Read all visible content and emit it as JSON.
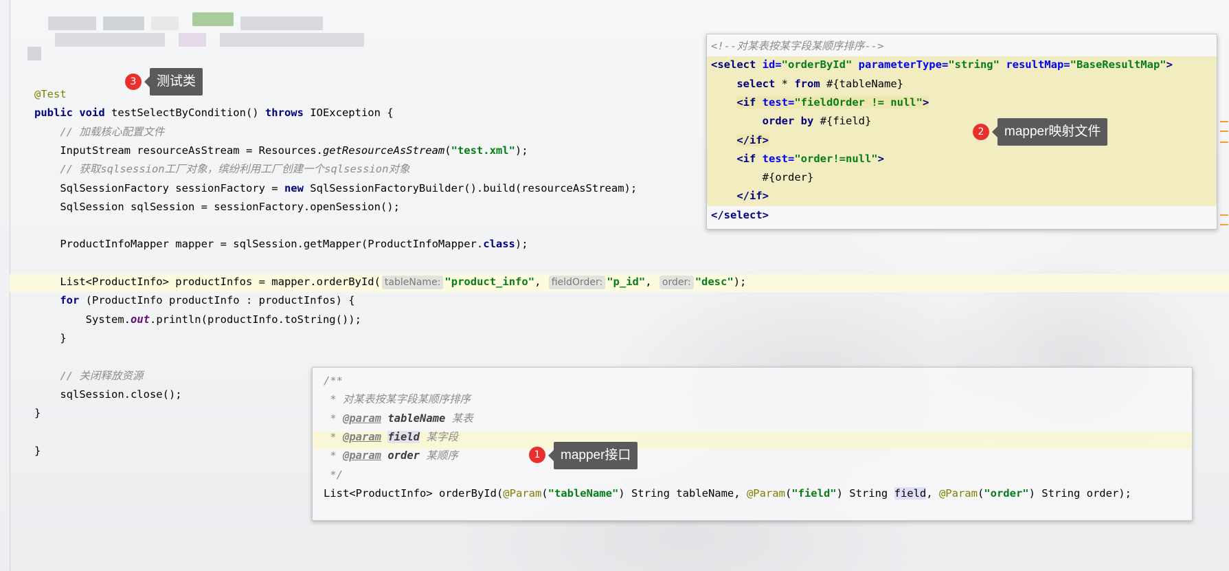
{
  "test_class": {
    "lines": [
      {
        "parts": [
          {
            "t": "@Test",
            "c": "ann"
          }
        ]
      },
      {
        "parts": [
          {
            "t": "public ",
            "c": "kw"
          },
          {
            "t": "void ",
            "c": "kw"
          },
          {
            "t": "testSelectByCondition() "
          },
          {
            "t": "throws ",
            "c": "kw"
          },
          {
            "t": "IOException {"
          }
        ]
      },
      {
        "parts": [
          {
            "t": "    // 加载核心配置文件",
            "c": "cmt"
          }
        ]
      },
      {
        "parts": [
          {
            "t": "    InputStream resourceAsStream = Resources."
          },
          {
            "t": "getResourceAsStream",
            "c": "static"
          },
          {
            "t": "("
          },
          {
            "t": "\"test.xml\"",
            "c": "str"
          },
          {
            "t": ");"
          }
        ]
      },
      {
        "parts": [
          {
            "t": "    // 获取sqlsession工厂对象，缤纷利用工厂创建一个sqlsession对象",
            "c": "cmt"
          }
        ]
      },
      {
        "parts": [
          {
            "t": "    SqlSessionFactory sessionFactory = "
          },
          {
            "t": "new ",
            "c": "kw"
          },
          {
            "t": "SqlSessionFactoryBuilder().build(resourceAsStream);"
          }
        ]
      },
      {
        "parts": [
          {
            "t": "    SqlSession sqlSession = sessionFactory.openSession();"
          }
        ]
      },
      {
        "parts": []
      },
      {
        "parts": [
          {
            "t": "    ProductInfoMapper mapper = sqlSession.getMapper(ProductInfoMapper."
          },
          {
            "t": "class",
            "c": "kw"
          },
          {
            "t": ");"
          }
        ]
      },
      {
        "parts": []
      },
      {
        "parts": [
          {
            "t": "    List<ProductInfo> productInfos = mapper.orderById("
          },
          {
            "t": "tableName:",
            "c": "hint"
          },
          {
            "t": "\"product_info\"",
            "c": "str"
          },
          {
            "t": ", "
          },
          {
            "t": "fieldOrder:",
            "c": "hint"
          },
          {
            "t": "\"p_id\"",
            "c": "str"
          },
          {
            "t": ", "
          },
          {
            "t": "order:",
            "c": "hint"
          },
          {
            "t": "\"desc\"",
            "c": "str"
          },
          {
            "t": ");"
          }
        ]
      },
      {
        "parts": [
          {
            "t": "    "
          },
          {
            "t": "for ",
            "c": "kw"
          },
          {
            "t": "(ProductInfo productInfo : productInfos) {"
          }
        ]
      },
      {
        "parts": [
          {
            "t": "        System."
          },
          {
            "t": "out",
            "c": "field"
          },
          {
            "t": ".println(productInfo.toString());"
          }
        ]
      },
      {
        "parts": [
          {
            "t": "    }"
          }
        ]
      },
      {
        "parts": []
      },
      {
        "parts": [
          {
            "t": "    // 关闭释放资源",
            "c": "cmt"
          }
        ]
      },
      {
        "parts": [
          {
            "t": "    sqlSession.close();"
          }
        ]
      },
      {
        "parts": [
          {
            "t": "}"
          }
        ]
      },
      {
        "parts": []
      },
      {
        "parts": [
          {
            "t": "}"
          }
        ]
      }
    ]
  },
  "mapper_xml": {
    "lines": [
      {
        "parts": [
          {
            "t": "<!--对某表按某字段某顺序排序-->",
            "c": "cmt"
          }
        ]
      },
      {
        "parts": [
          {
            "t": "<select ",
            "c": "xml-tag"
          },
          {
            "t": "id=",
            "c": "xml-attr"
          },
          {
            "t": "\"orderById\"",
            "c": "xml-val"
          },
          {
            "t": " "
          },
          {
            "t": "parameterType=",
            "c": "xml-attr"
          },
          {
            "t": "\"string\"",
            "c": "xml-val"
          },
          {
            "t": " "
          },
          {
            "t": "resultMap=",
            "c": "xml-attr"
          },
          {
            "t": "\"BaseResultMap\"",
            "c": "xml-val"
          },
          {
            "t": ">",
            "c": "xml-tag"
          }
        ]
      },
      {
        "parts": [
          {
            "t": "    "
          },
          {
            "t": "select ",
            "c": "kw"
          },
          {
            "t": "* "
          },
          {
            "t": "from ",
            "c": "kw"
          },
          {
            "t": "#{tableName}"
          }
        ]
      },
      {
        "parts": [
          {
            "t": "    "
          },
          {
            "t": "<if ",
            "c": "xml-tag xml-hl"
          },
          {
            "t": "test=",
            "c": "xml-attr xml-hl"
          },
          {
            "t": "\"fieldOrder != null\"",
            "c": "xml-val xml-hl"
          },
          {
            "t": ">",
            "c": "xml-tag xml-hl"
          }
        ]
      },
      {
        "parts": [
          {
            "t": "        "
          },
          {
            "t": "order by ",
            "c": "kw"
          },
          {
            "t": "#{field}"
          }
        ]
      },
      {
        "parts": [
          {
            "t": "    "
          },
          {
            "t": "</if>",
            "c": "xml-tag xml-hl"
          }
        ]
      },
      {
        "parts": [
          {
            "t": "    "
          },
          {
            "t": "<if ",
            "c": "xml-tag"
          },
          {
            "t": "test=",
            "c": "xml-attr"
          },
          {
            "t": "\"order!=null\"",
            "c": "xml-val"
          },
          {
            "t": ">",
            "c": "xml-tag"
          }
        ]
      },
      {
        "parts": [
          {
            "t": "        #{order}"
          }
        ]
      },
      {
        "parts": [
          {
            "t": "    "
          },
          {
            "t": "</if>",
            "c": "xml-tag"
          }
        ]
      },
      {
        "parts": [
          {
            "t": "</select>",
            "c": "xml-tag"
          }
        ]
      }
    ]
  },
  "mapper_interface": {
    "lines": [
      {
        "parts": [
          {
            "t": "/**",
            "c": "cmt"
          }
        ]
      },
      {
        "parts": [
          {
            "t": " * 对某表按某字段某顺序排序",
            "c": "cmt"
          }
        ]
      },
      {
        "parts": [
          {
            "t": " * ",
            "c": "cmt"
          },
          {
            "t": "@param",
            "c": "doctag"
          },
          {
            "t": " "
          },
          {
            "t": "tableName",
            "c": "docparam"
          },
          {
            "t": " 某表",
            "c": "cmt"
          }
        ]
      },
      {
        "parts": [
          {
            "t": " * ",
            "c": "cmt"
          },
          {
            "t": "@param",
            "c": "doctag"
          },
          {
            "t": " "
          },
          {
            "t": "field",
            "c": "docparam docparam-hl"
          },
          {
            "t": " 某字段",
            "c": "cmt"
          }
        ]
      },
      {
        "parts": [
          {
            "t": " * ",
            "c": "cmt"
          },
          {
            "t": "@param",
            "c": "doctag"
          },
          {
            "t": " "
          },
          {
            "t": "order",
            "c": "docparam"
          },
          {
            "t": " 某顺序",
            "c": "cmt"
          }
        ]
      },
      {
        "parts": [
          {
            "t": " */",
            "c": "cmt"
          }
        ]
      },
      {
        "parts": [
          {
            "t": "List<ProductInfo> orderById("
          },
          {
            "t": "@Param",
            "c": "ann"
          },
          {
            "t": "("
          },
          {
            "t": "\"tableName\"",
            "c": "str"
          },
          {
            "t": ") String tableName, "
          },
          {
            "t": "@Param",
            "c": "ann"
          },
          {
            "t": "("
          },
          {
            "t": "\"field\"",
            "c": "str"
          },
          {
            "t": ") String "
          },
          {
            "t": "field",
            "c": "docparam-hl"
          },
          {
            "t": ", "
          },
          {
            "t": "@Param",
            "c": "ann"
          },
          {
            "t": "("
          },
          {
            "t": "\"order\"",
            "c": "str"
          },
          {
            "t": ") String order);"
          }
        ]
      }
    ]
  },
  "callouts": {
    "c1": {
      "num": "1",
      "label": "mapper接口"
    },
    "c2": {
      "num": "2",
      "label": "mapper映射文件"
    },
    "c3": {
      "num": "3",
      "label": "测试类"
    }
  },
  "colors": {
    "keyword": "#000080",
    "string": "#067d17",
    "annotation": "#808000",
    "comment": "#8c8c8c",
    "badge": "#e8312f"
  }
}
